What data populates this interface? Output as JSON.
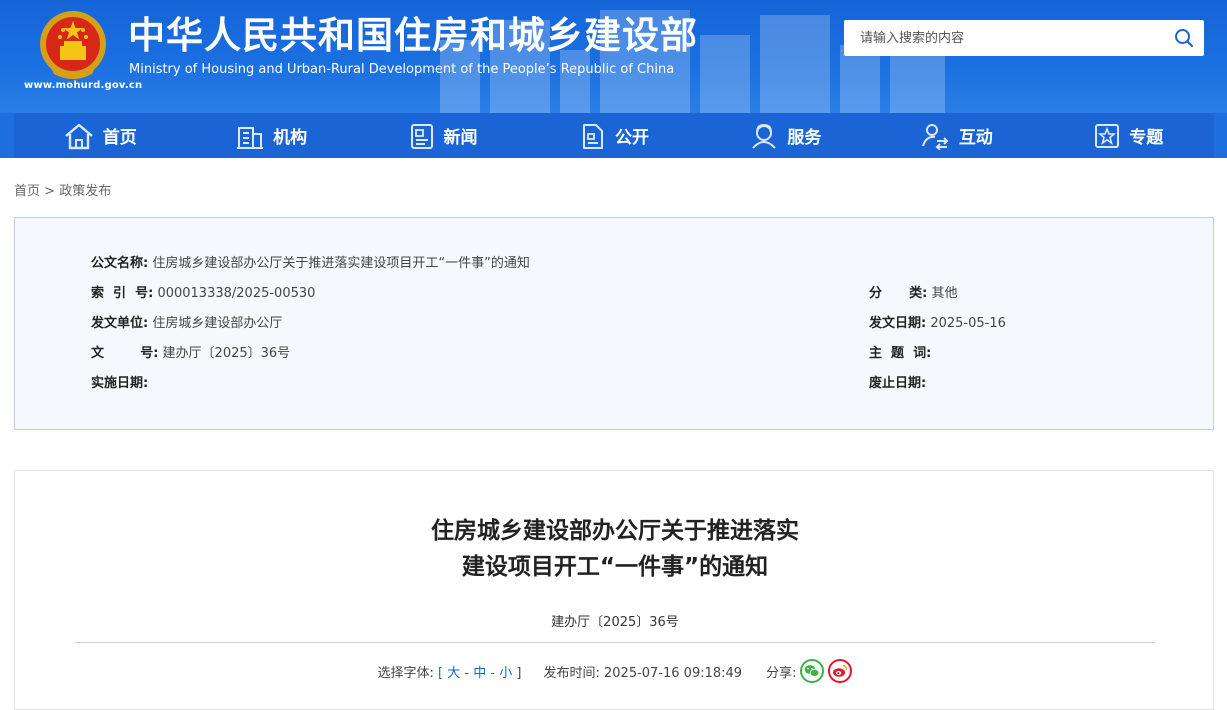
{
  "header": {
    "title_cn": "中华人民共和国住房和城乡建设部",
    "title_en": "Ministry of Housing and Urban-Rural Development of the People’s Republic of China",
    "domain": "www.mohurd.gov.cn",
    "emblem_icon": "national-emblem-icon",
    "search_placeholder": "请输入搜索的内容",
    "search_icon": "search-icon"
  },
  "nav": {
    "items": [
      {
        "label": "首页",
        "icon": "home-icon"
      },
      {
        "label": "机构",
        "icon": "building-icon"
      },
      {
        "label": "新闻",
        "icon": "news-icon"
      },
      {
        "label": "公开",
        "icon": "document-icon"
      },
      {
        "label": "服务",
        "icon": "service-icon"
      },
      {
        "label": "互动",
        "icon": "interaction-icon"
      },
      {
        "label": "专题",
        "icon": "star-icon"
      }
    ]
  },
  "breadcrumb": {
    "home": "首页",
    "sep": " > ",
    "current": "政策发布"
  },
  "meta": {
    "doc_name_label": "公文名称:",
    "doc_name": "住房城乡建设部办公厅关于推进落实建设项目开工“一件事”的通知",
    "index_label": "索  引  号:",
    "index": "000013338/2025-00530",
    "category_label": "分      类:",
    "category": "其他",
    "issuer_label": "发文单位:",
    "issuer": "住房城乡建设部办公厅",
    "issue_date_label": "发文日期:",
    "issue_date": "2025-05-16",
    "doc_no_label": "文        号:",
    "doc_no": "建办厅〔2025〕36号",
    "keywords_label": "主  题  词:",
    "keywords": "",
    "effective_label": "实施日期:",
    "effective": "",
    "expiry_label": "废止日期:",
    "expiry": ""
  },
  "article": {
    "title_line1": "住房城乡建设部办公厅关于推进落实",
    "title_line2": "建设项目开工“一件事”的通知",
    "doc_no": "建办厅〔2025〕36号",
    "font_label": "选择字体:",
    "font_open": "[ ",
    "font_large": "大",
    "font_dash1": " - ",
    "font_medium": "中",
    "font_dash2": " - ",
    "font_small": "小",
    "font_close": " ]",
    "pub_label": "发布时间:",
    "pub_time": "2025-07-16 09:18:49",
    "share_label": "分享:",
    "share_wechat_icon": "wechat-icon",
    "share_weibo_icon": "weibo-icon",
    "colors": {
      "wechat": "#3bb443",
      "weibo": "#e6162d"
    }
  },
  "colors": {
    "header_blue": "#1565d8",
    "nav_blue": "#1a64d6",
    "meta_bg": "#f5f9fd",
    "meta_border": "#b9d0ea"
  }
}
